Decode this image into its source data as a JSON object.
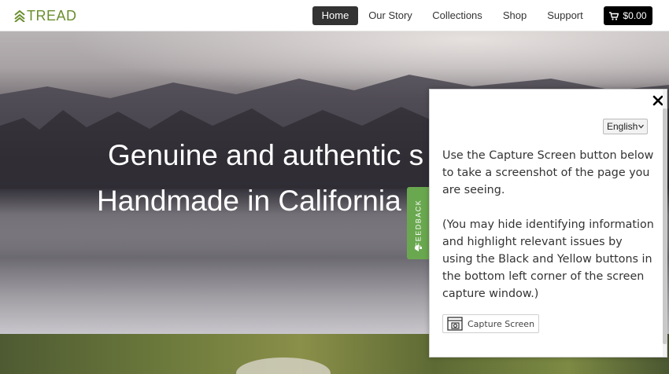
{
  "brand": {
    "name": "TREAD",
    "accent_color": "#6a8f2d"
  },
  "nav": {
    "items": [
      {
        "label": "Home",
        "active": true
      },
      {
        "label": "Our Story",
        "active": false
      },
      {
        "label": "Collections",
        "active": false
      },
      {
        "label": "Shop",
        "active": false
      },
      {
        "label": "Support",
        "active": false
      }
    ],
    "cart": {
      "icon": "shopping-cart-icon",
      "total": "$0.00"
    }
  },
  "hero": {
    "line1": "Genuine and authentic s",
    "line2": "Handmade in California"
  },
  "feedback_tab": {
    "label": "FEEDBACK",
    "color": "#6aa84f",
    "icon": "megaphone-icon"
  },
  "panel": {
    "close_icon": "close-icon",
    "language": {
      "selected": "English"
    },
    "instructions": "Use the Capture Screen button below to take a screenshot of the page you are seeing.",
    "note": "(You may hide identifying information and highlight relevant issues by using the Black and Yellow buttons in the bottom left corner of the screen capture window.)",
    "capture_button": {
      "label": "Capture Screen",
      "icon": "camera-icon"
    }
  }
}
